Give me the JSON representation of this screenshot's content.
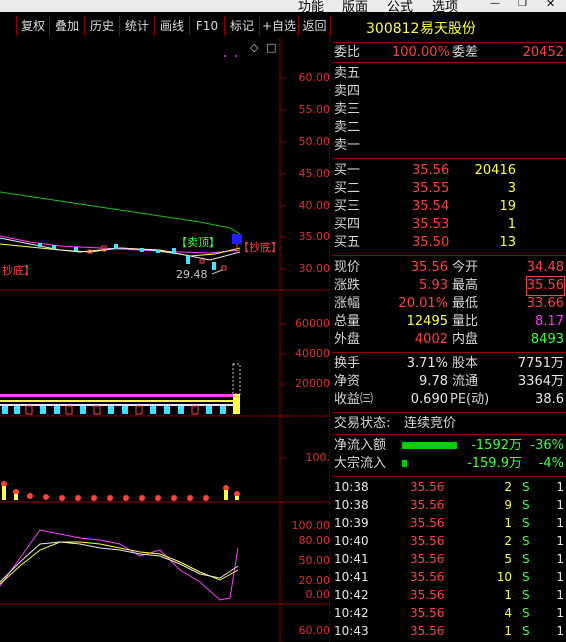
{
  "menu": [
    "功能",
    "版面",
    "公式",
    "选项"
  ],
  "toolbar": [
    "复权",
    "叠加",
    "历史",
    "统计",
    "画线",
    "F10",
    "标记",
    "+自选",
    "返回"
  ],
  "stock": {
    "code": "300812",
    "name": "易天股份"
  },
  "price_axis": [
    "60.00",
    "55.00",
    "50.00",
    "45.00",
    "40.00",
    "35.00",
    "30.00"
  ],
  "volume_axis": [
    "60000",
    "40000",
    "20000"
  ],
  "ind_axis": [
    "100."
  ],
  "kdj_axis": [
    "100.00",
    "80.00",
    "50.00",
    "20.00",
    "0.00"
  ],
  "bottom_axis": "60.00",
  "annotations": {
    "sell_top": "【卖顶】",
    "buy_bottom_right": "【抄底】",
    "buy_bottom_left": "抄底】",
    "low_price": "29.48"
  },
  "weibi": {
    "label": "委比",
    "value": "100.00%",
    "label2": "委差",
    "value2": "20452"
  },
  "sell_levels": [
    "卖五",
    "卖四",
    "卖三",
    "卖二",
    "卖一"
  ],
  "buy_levels": [
    {
      "label": "买一",
      "price": "35.56",
      "vol": "20416"
    },
    {
      "label": "买二",
      "price": "35.55",
      "vol": "3"
    },
    {
      "label": "买三",
      "price": "35.54",
      "vol": "19"
    },
    {
      "label": "买四",
      "price": "35.53",
      "vol": "1"
    },
    {
      "label": "买五",
      "price": "35.50",
      "vol": "13"
    }
  ],
  "quote": {
    "xianjia": {
      "label": "现价",
      "value": "35.56",
      "label2": "今开",
      "value2": "34.48"
    },
    "zhangdie": {
      "label": "涨跌",
      "value": "5.93",
      "label2": "最高",
      "value2": "35.56"
    },
    "zhangfu": {
      "label": "涨幅",
      "value": "20.01%",
      "label2": "最低",
      "value2": "33.66"
    },
    "zongliang": {
      "label": "总量",
      "value": "12495",
      "label2": "量比",
      "value2": "8.17"
    },
    "waipan": {
      "label": "外盘",
      "value": "4002",
      "label2": "内盘",
      "value2": "8493"
    },
    "huanshou": {
      "label": "换手",
      "value": "3.71%",
      "label2": "股本",
      "value2": "7751万"
    },
    "jingzi": {
      "label": "净资",
      "value": "9.78",
      "label2": "流通",
      "value2": "3364万"
    },
    "shouyi": {
      "label": "收益㈢",
      "value": "0.690",
      "label2": "PE(动)",
      "value2": "38.6"
    }
  },
  "trade_status": {
    "label": "交易状态:",
    "value": "连续竞价"
  },
  "flows": [
    {
      "label": "净流入额",
      "amount": "-1592万",
      "pct": "-36%",
      "bar": 0.8
    },
    {
      "label": "大宗流入",
      "amount": "-159.9万",
      "pct": "-4%",
      "bar": 0.05
    }
  ],
  "ticks": [
    {
      "time": "10:38",
      "price": "35.56",
      "vol": "2",
      "side": "S",
      "n": "1"
    },
    {
      "time": "10:38",
      "price": "35.56",
      "vol": "9",
      "side": "S",
      "n": "1"
    },
    {
      "time": "10:39",
      "price": "35.56",
      "vol": "1",
      "side": "S",
      "n": "1"
    },
    {
      "time": "10:40",
      "price": "35.56",
      "vol": "2",
      "side": "S",
      "n": "1"
    },
    {
      "time": "10:41",
      "price": "35.56",
      "vol": "5",
      "side": "S",
      "n": "1"
    },
    {
      "time": "10:41",
      "price": "35.56",
      "vol": "10",
      "side": "S",
      "n": "1"
    },
    {
      "time": "10:42",
      "price": "35.56",
      "vol": "1",
      "side": "S",
      "n": "1"
    },
    {
      "time": "10:42",
      "price": "35.56",
      "vol": "4",
      "side": "S",
      "n": "1"
    },
    {
      "time": "10:43",
      "price": "35.56",
      "vol": "1",
      "side": "S",
      "n": "1"
    }
  ],
  "colors": {
    "up": "#ff4040",
    "down": "#40ff40",
    "accent": "#ffff40",
    "grid": "#8b0000"
  }
}
